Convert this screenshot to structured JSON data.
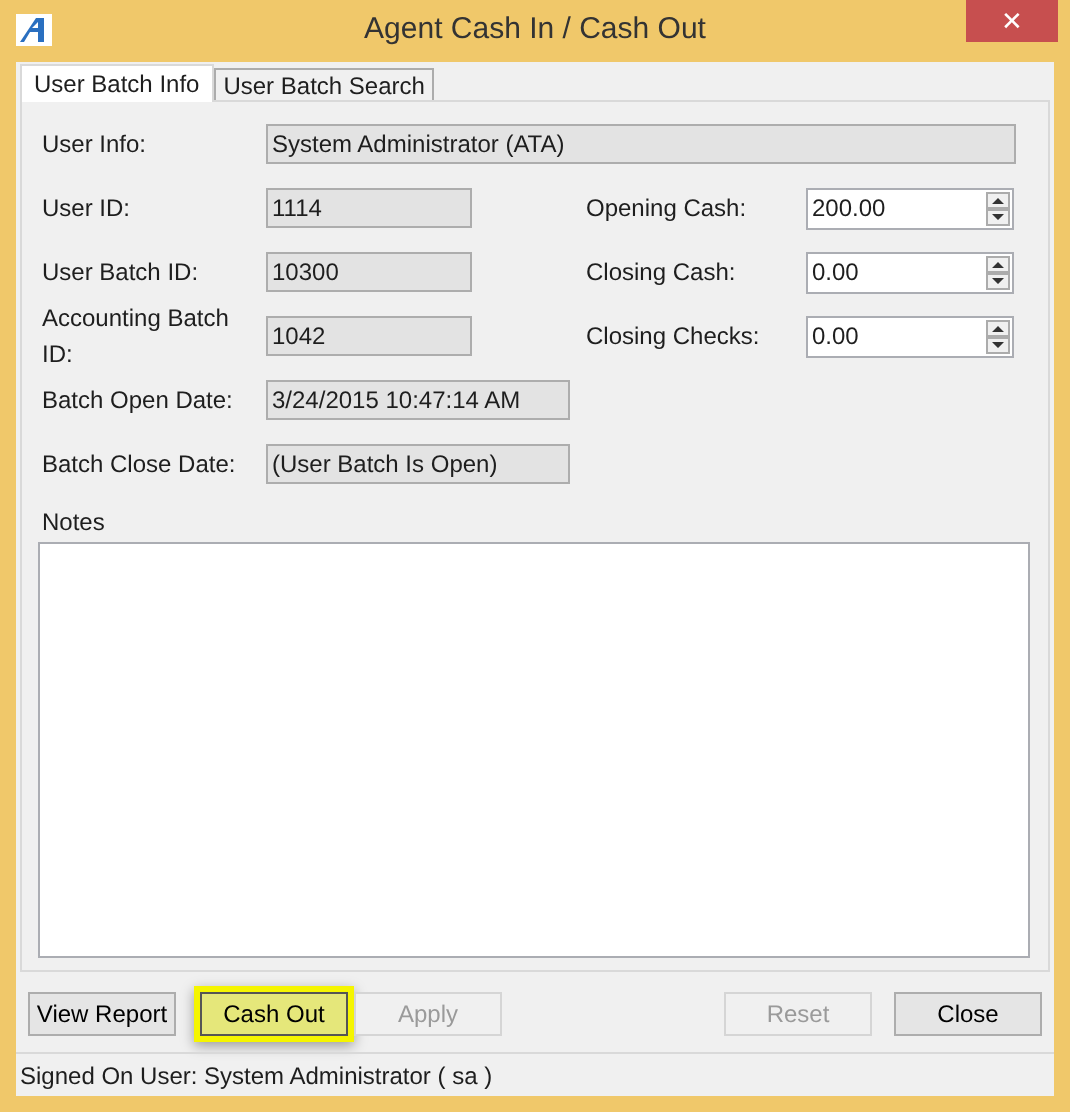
{
  "window": {
    "title": "Agent Cash In / Cash Out",
    "close": "✕"
  },
  "tabs": [
    {
      "label": "User Batch Info",
      "selected": true
    },
    {
      "label": "User Batch Search",
      "selected": false
    }
  ],
  "fields": [
    {
      "label": "User Info:",
      "value": "System Administrator (ATA)",
      "kind": "full"
    },
    {
      "label": "User ID:",
      "value": "1114",
      "kind": "short"
    },
    {
      "label": "User Batch ID:",
      "value": "10300",
      "kind": "short"
    },
    {
      "label": "Accounting Batch ID:",
      "value": "1042",
      "kind": "short"
    },
    {
      "label": "Batch Open Date:",
      "value": "3/24/2015 10:47:14 AM",
      "kind": "long"
    },
    {
      "label": "Batch Close Date:",
      "value": "(User Batch Is Open)",
      "kind": "long"
    }
  ],
  "amounts": [
    {
      "label": "Opening Cash:",
      "value": "200.00"
    },
    {
      "label": "Closing Cash:",
      "value": "0.00"
    },
    {
      "label": "Closing Checks:",
      "value": "0.00"
    }
  ],
  "notes": {
    "label": "Notes"
  },
  "buttons": [
    {
      "label": "View Report",
      "disabled": false,
      "highlighted": false
    },
    {
      "label": "Cash Out",
      "disabled": false,
      "highlighted": true
    },
    {
      "label": "Apply",
      "disabled": true,
      "highlighted": false
    },
    {
      "label": "Reset",
      "disabled": true,
      "highlighted": false
    },
    {
      "label": "Close",
      "disabled": false,
      "highlighted": false
    }
  ],
  "status_bar": "Signed On User: System Administrator ( sa )"
}
